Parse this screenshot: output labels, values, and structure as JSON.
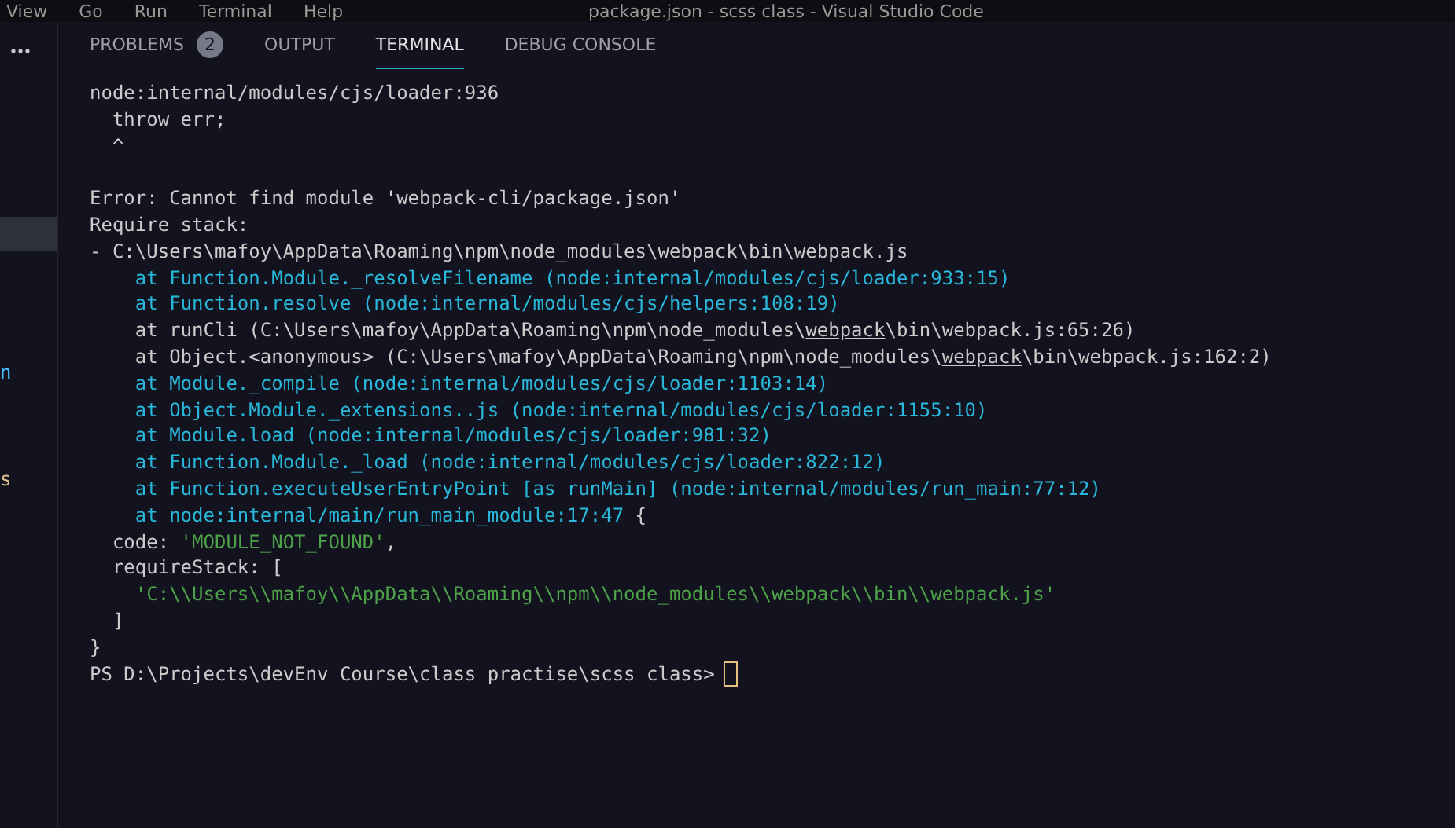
{
  "menu_bar": [
    "View",
    "Go",
    "Run",
    "Terminal",
    "Help"
  ],
  "window": {
    "title": "package.json - scss class - Visual Studio Code"
  },
  "sidebar": {
    "fragments": [
      {
        "text": "n",
        "color": "#4fc1ff"
      },
      {
        "text": "s",
        "color": "#e2c08d"
      }
    ]
  },
  "panel_tabs": [
    {
      "label": "PROBLEMS",
      "badge": "2",
      "selected": false
    },
    {
      "label": "OUTPUT",
      "selected": false
    },
    {
      "label": "TERMINAL",
      "selected": true
    },
    {
      "label": "DEBUG CONSOLE",
      "selected": false
    }
  ],
  "terminal": {
    "lines": [
      [
        {
          "kind": "plain",
          "text": "node:internal/modules/cjs/loader:936"
        }
      ],
      [
        {
          "kind": "plain",
          "text": "  throw err;"
        }
      ],
      [
        {
          "kind": "plain",
          "text": "  ^"
        }
      ],
      [
        {
          "kind": "blank"
        }
      ],
      [
        {
          "kind": "plain",
          "text": "Error: Cannot find module 'webpack-cli/package.json'"
        }
      ],
      [
        {
          "kind": "plain",
          "text": "Require stack:"
        }
      ],
      [
        {
          "kind": "plain",
          "text": "- C:\\Users\\mafoy\\AppData\\Roaming\\npm\\node_modules\\webpack\\bin\\webpack.js"
        }
      ],
      [
        {
          "kind": "trace",
          "text": "    at Function.Module._resolveFilename (node:internal/modules/cjs/loader:933:15)"
        }
      ],
      [
        {
          "kind": "trace",
          "text": "    at Function.resolve (node:internal/modules/cjs/helpers:108:19)"
        }
      ],
      [
        {
          "kind": "plain",
          "text": "    at runCli (C:\\Users\\mafoy\\AppData\\Roaming\\npm\\node_modules\\"
        },
        {
          "kind": "link",
          "text": "webpack"
        },
        {
          "kind": "plain",
          "text": "\\bin\\webpack.js:65:26)"
        }
      ],
      [
        {
          "kind": "plain",
          "text": "    at Object.<anonymous> (C:\\Users\\mafoy\\AppData\\Roaming\\npm\\node_modules\\"
        },
        {
          "kind": "link",
          "text": "webpack"
        },
        {
          "kind": "plain",
          "text": "\\bin\\webpack.js:162:2)"
        }
      ],
      [
        {
          "kind": "trace",
          "text": "    at Module._compile (node:internal/modules/cjs/loader:1103:14)"
        }
      ],
      [
        {
          "kind": "trace",
          "text": "    at Object.Module._extensions..js (node:internal/modules/cjs/loader:1155:10)"
        }
      ],
      [
        {
          "kind": "trace",
          "text": "    at Module.load (node:internal/modules/cjs/loader:981:32)"
        }
      ],
      [
        {
          "kind": "trace",
          "text": "    at Function.Module._load (node:internal/modules/cjs/loader:822:12)"
        }
      ],
      [
        {
          "kind": "trace",
          "text": "    at Function.executeUserEntryPoint [as runMain] (node:internal/modules/run_main:77:12)"
        }
      ],
      [
        {
          "kind": "trace",
          "text": "    at node:internal/main/run_main_module:17:47"
        },
        {
          "kind": "plain",
          "text": " {"
        }
      ],
      [
        {
          "kind": "plain",
          "text": "  code: "
        },
        {
          "kind": "string",
          "text": "'MODULE_NOT_FOUND'"
        },
        {
          "kind": "plain",
          "text": ","
        }
      ],
      [
        {
          "kind": "plain",
          "text": "  requireStack: ["
        }
      ],
      [
        {
          "kind": "string",
          "text": "    'C:\\\\Users\\\\mafoy\\\\AppData\\\\Roaming\\\\npm\\\\node_modules\\\\webpack\\\\bin\\\\webpack.js'"
        }
      ],
      [
        {
          "kind": "plain",
          "text": "  ]"
        }
      ],
      [
        {
          "kind": "plain",
          "text": "}"
        }
      ]
    ],
    "prompt": "PS D:\\Projects\\devEnv Course\\class practise\\scss class>"
  }
}
